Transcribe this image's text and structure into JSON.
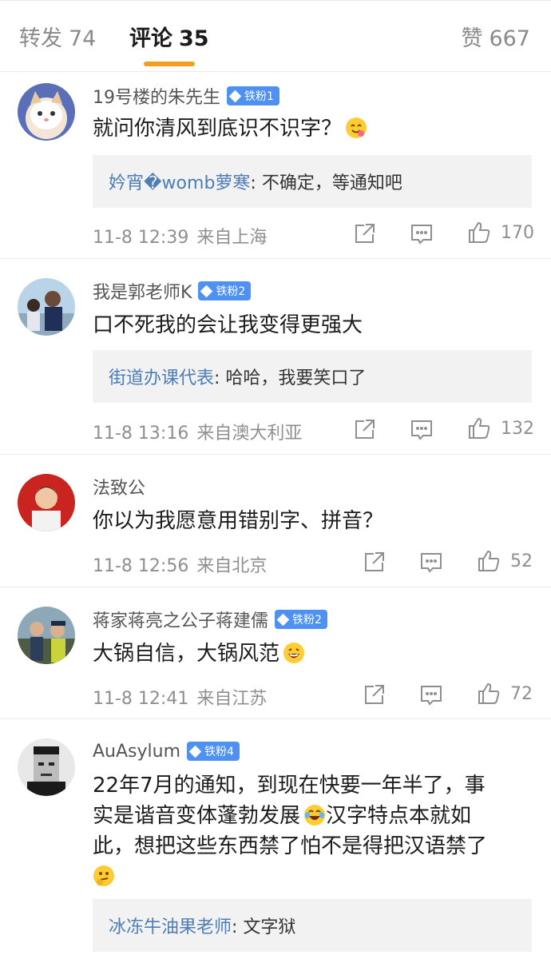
{
  "tabs": {
    "forward_label": "转发",
    "forward_count": "74",
    "comment_label": "评论",
    "comment_count": "35",
    "like_label": "赞",
    "like_count": "667"
  },
  "colors": {
    "accent": "#f29d1f",
    "link": "#4d7db5",
    "badge": "#4f90f3"
  },
  "comments": [
    {
      "username": "19号楼的朱先生",
      "badge": "铁粉1",
      "text": "就问你清风到底识不识字？",
      "emoji": "smile-icon",
      "reply": {
        "author": "妗宵�womb萝寒",
        "text": ": 不确定，等通知吧"
      },
      "date": "11-8 12:39",
      "location": "来自上海",
      "likes": "170"
    },
    {
      "username": "我是郭老师K",
      "badge": "铁粉2",
      "text": "口不死我的会让我变得更强大",
      "reply": {
        "author": "街道办课代表",
        "text": ": 哈哈，我要笑口了"
      },
      "date": "11-8 13:16",
      "location": "来自澳大利亚",
      "likes": "132"
    },
    {
      "username": "法致公",
      "text": "你以为我愿意用错别字、拼音？",
      "date": "11-8 12:56",
      "location": "来自北京",
      "likes": "52"
    },
    {
      "username": "蒋家蒋亮之公子蒋建儒",
      "badge": "铁粉2",
      "text": "大锅自信，大锅风范",
      "emoji": "laugh-icon",
      "date": "11-8 12:41",
      "location": "来自江苏",
      "likes": "72"
    },
    {
      "username": "AuAsylum",
      "badge": "铁粉4",
      "text_line1": "22年7月的通知，到现在快要一年半了，事",
      "text_line2": "实是谐音变体蓬勃发展",
      "text_line2b": "汉字特点本就如",
      "text_line3": "此，想把这些东西禁了怕不是得把汉语禁了",
      "reply": {
        "author": "冰冻牛油果老师",
        "text": ": 文字狱"
      }
    }
  ]
}
